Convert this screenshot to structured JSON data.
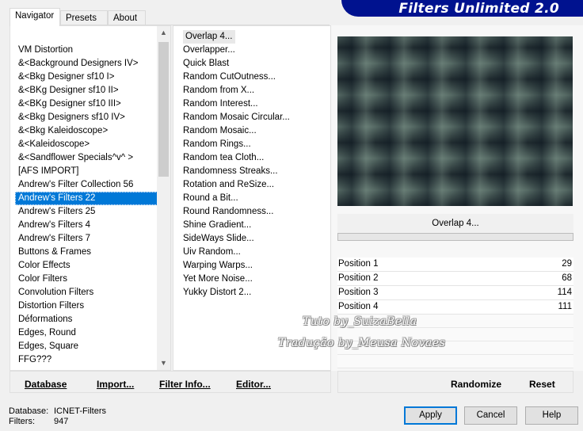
{
  "tabs": [
    "Navigator",
    "Presets",
    "About"
  ],
  "banner": "Filters Unlimited 2.0",
  "categories": [
    "VM Distortion",
    "&<Background Designers IV>",
    "&<Bkg Designer sf10 I>",
    "&<BKg Designer sf10 II>",
    "&<BKg Designer sf10 III>",
    "&<Bkg Designers sf10 IV>",
    "&<Bkg Kaleidoscope>",
    "&<Kaleidoscope>",
    "&<Sandflower Specials^v^ >",
    "[AFS IMPORT]",
    "Andrew's Filter Collection 56",
    "Andrew's Filters 22",
    "Andrew's Filters 25",
    "Andrew's Filters 4",
    "Andrew's Filters 7",
    "Buttons & Frames",
    "Color Effects",
    "Color Filters",
    "Convolution Filters",
    "Distortion Filters",
    "Déformations",
    "Edges, Round",
    "Edges, Square",
    "FFG???"
  ],
  "selected_category": "Andrew's Filters 22",
  "filters": [
    "Overlap 4...",
    "Overlapper...",
    "Quick Blast",
    "Random CutOutness...",
    "Random from X...",
    "Random Interest...",
    "Random Mosaic Circular...",
    "Random Mosaic...",
    "Random Rings...",
    "Random tea Cloth...",
    "Randomness Streaks...",
    "Rotation and ReSize...",
    "Round a Bit...",
    "Round Randomness...",
    "Shine Gradient...",
    "SideWays Slide...",
    "Uiv Random...",
    "Warping Warps...",
    "Yet More Noise...",
    "Yukky Distort 2..."
  ],
  "current_filter": "Overlap 4...",
  "params": [
    {
      "label": "Position 1",
      "value": "29"
    },
    {
      "label": "Position 2",
      "value": "68"
    },
    {
      "label": "Position 3",
      "value": "114"
    },
    {
      "label": "Position 4",
      "value": "111"
    }
  ],
  "watermark": {
    "line1": "Tuto by_SuizaBella",
    "line2": "Tradução by_Meusa Novaes"
  },
  "actions": {
    "database": "Database",
    "import": "Import...",
    "filter_info": "Filter Info...",
    "editor": "Editor...",
    "randomize": "Randomize",
    "reset": "Reset"
  },
  "status": {
    "database_label": "Database:",
    "database_value": "ICNET-Filters",
    "filters_label": "Filters:",
    "filters_value": "947"
  },
  "buttons": {
    "apply": "Apply",
    "cancel": "Cancel",
    "help": "Help"
  },
  "colors": {
    "banner": "#00128f",
    "selection": "#0078d7"
  }
}
